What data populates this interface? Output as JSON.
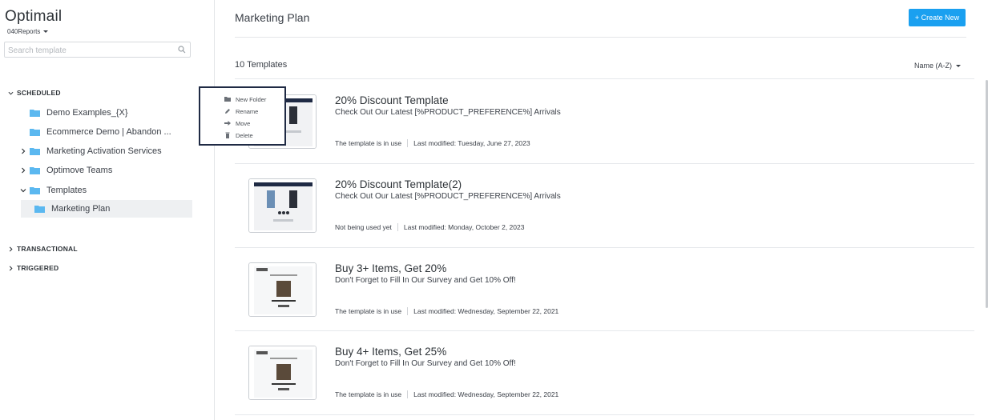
{
  "app": {
    "title": "Optimail",
    "account": "040Reports"
  },
  "search": {
    "placeholder": "Search template"
  },
  "sidebar": {
    "scheduled_label": "SCHEDULED",
    "folders": [
      {
        "label": "Demo Examples_{X}"
      },
      {
        "label": "Ecommerce Demo | Abandon ..."
      },
      {
        "label": "Marketing Activation Services"
      },
      {
        "label": "Optimove Teams"
      },
      {
        "label": "Templates"
      },
      {
        "label": "Marketing Plan"
      }
    ],
    "transactional_label": "TRANSACTIONAL",
    "triggered_label": "TRIGGERED"
  },
  "context_menu": {
    "items": [
      {
        "label": "New Folder",
        "icon": "new-folder-icon"
      },
      {
        "label": "Rename",
        "icon": "pencil-icon"
      },
      {
        "label": "Move",
        "icon": "arrow-right-icon"
      },
      {
        "label": "Delete",
        "icon": "trash-icon"
      }
    ]
  },
  "main": {
    "title": "Marketing Plan",
    "create_label": "+ Create New",
    "count_label": "10 Templates",
    "sort_label": "Name (A-Z)",
    "templates": [
      {
        "title": "20% Discount Template",
        "subtitle": "Check Out Our Latest [%PRODUCT_PREFERENCE%] Arrivals",
        "status": "The template is in use",
        "modified": "Last modified: Tuesday, June 27, 2023"
      },
      {
        "title": "20% Discount Template(2)",
        "subtitle": "Check Out Our Latest [%PRODUCT_PREFERENCE%] Arrivals",
        "status": "Not being used yet",
        "modified": "Last modified: Monday, October 2, 2023"
      },
      {
        "title": "Buy 3+ Items, Get 20%",
        "subtitle": "Don't Forget to Fill In Our Survey and Get 10% Off!",
        "status": "The template is in use",
        "modified": "Last modified: Wednesday, September 22, 2021"
      },
      {
        "title": "Buy 4+ Items, Get 25%",
        "subtitle": "Don't Forget to Fill In Our Survey and Get 10% Off!",
        "status": "The template is in use",
        "modified": "Last modified: Wednesday, September 22, 2021"
      }
    ]
  },
  "colors": {
    "accent": "#1aa0f0",
    "folder": "#5bb8f0",
    "menu_border": "#1f2a44"
  }
}
